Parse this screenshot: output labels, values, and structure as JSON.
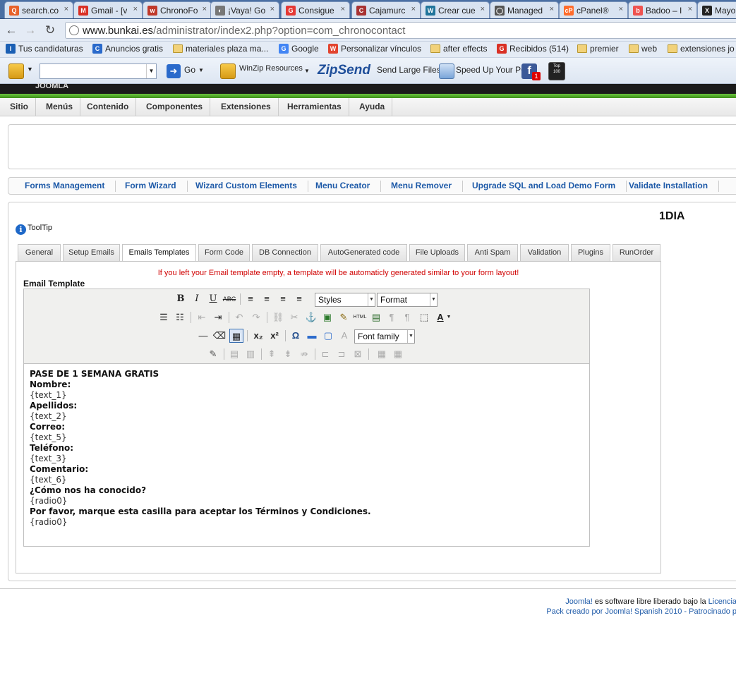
{
  "browser": {
    "tabs": [
      {
        "label": "search.co",
        "color": "#e8622a",
        "glyph": "Q"
      },
      {
        "label": "Gmail - [v",
        "color": "#d93025",
        "glyph": "M"
      },
      {
        "label": "ChronoFo",
        "color": "#c0392b",
        "glyph": "w"
      },
      {
        "label": "¡Vaya! Go",
        "color": "#777777",
        "glyph": "◐"
      },
      {
        "label": "Consigue",
        "color": "#e53935",
        "glyph": "G"
      },
      {
        "label": "Cajamurc",
        "color": "#a83232",
        "glyph": "C"
      },
      {
        "label": "Crear cue",
        "color": "#21759b",
        "glyph": "W"
      },
      {
        "label": "Managed",
        "color": "#555555",
        "glyph": "◯"
      },
      {
        "label": "cPanel®",
        "color": "#ff6c2c",
        "glyph": "cP"
      },
      {
        "label": "Badoo – I",
        "color": "#ef5350",
        "glyph": "b"
      },
      {
        "label": "Mayo",
        "color": "#222222",
        "glyph": "X"
      }
    ],
    "url_host": "www.bunkai.es",
    "url_path": "/administrator/index2.php?option=com_chronocontact",
    "bookmarks": [
      {
        "label": "Tus candidaturas",
        "icon": "infojobs-icon",
        "color": "#1a5fb4"
      },
      {
        "label": "Anuncios gratis",
        "icon": "c-icon",
        "color": "#2a6acb"
      },
      {
        "label": "materiales plaza ma...",
        "icon": "folder-icon",
        "color": ""
      },
      {
        "label": "Google",
        "icon": "google-icon",
        "color": "#4285f4"
      },
      {
        "label": "Personalizar vínculos",
        "icon": "windows-icon",
        "color": "#e2442f"
      },
      {
        "label": "after effects",
        "icon": "folder-icon",
        "color": ""
      },
      {
        "label": "Recibidos (514)",
        "icon": "gmail-icon",
        "color": "#d93025"
      },
      {
        "label": "premier",
        "icon": "folder-icon",
        "color": ""
      },
      {
        "label": "web",
        "icon": "folder-icon",
        "color": ""
      },
      {
        "label": "extensiones jo",
        "icon": "folder-icon",
        "color": ""
      }
    ],
    "toolbar": {
      "go_label": "Go",
      "winzip_label": "WinZip Resources",
      "zipsend_label": "ZipSend",
      "send_files_label": "Send Large Files",
      "speed_label": "Speed Up Your PC",
      "fb_badge": "1",
      "top_badge": "Top 100"
    }
  },
  "joomla": {
    "logo_text": "JOOMLA",
    "menu": [
      "Sitio",
      "Menús",
      "Contenido",
      "Componentes",
      "Extensiones",
      "Herramientas",
      "Ayuda"
    ],
    "submenu": [
      "Forms Management",
      "Form Wizard",
      "Wizard Custom Elements",
      "Menu Creator",
      "Menu Remover",
      "Upgrade SQL and Load Demo Form",
      "Validate Installation"
    ],
    "form_name": "1DIA",
    "tooltip_label": "ToolTip",
    "tabs": [
      "General",
      "Setup Emails",
      "Emails Templates",
      "Form Code",
      "DB Connection",
      "AutoGenerated code",
      "File Uploads",
      "Anti Spam",
      "Validation",
      "Plugins",
      "RunOrder"
    ],
    "active_tab": "Emails Templates",
    "warning": "If you left your Email template empty, a template will be automaticly generated similar to your form layout!",
    "email_template_label": "Email Template",
    "editor": {
      "styles_label": "Styles",
      "format_label": "Format",
      "font_family_label": "Font family",
      "content": [
        {
          "text": "PASE DE 1 SEMANA GRATIS",
          "bold": true
        },
        {
          "text": "Nombre:",
          "bold": true
        },
        {
          "text": "{text_1}",
          "bold": false
        },
        {
          "text": "Apellidos:",
          "bold": true
        },
        {
          "text": "{text_2}",
          "bold": false
        },
        {
          "text": "Correo:",
          "bold": true
        },
        {
          "text": "{text_5}",
          "bold": false
        },
        {
          "text": "Teléfono:",
          "bold": true
        },
        {
          "text": "{text_3}",
          "bold": false
        },
        {
          "text": "Comentario:",
          "bold": true
        },
        {
          "text": "{text_6}",
          "bold": false
        },
        {
          "text": "¿Cómo nos ha conocido?",
          "bold": true
        },
        {
          "text": "{radio0}",
          "bold": false
        },
        {
          "text": "Por favor, marque esta casilla para aceptar los Términos y Condiciones.",
          "bold": true
        },
        {
          "text": "{radio0}",
          "bold": false
        }
      ]
    },
    "footer": {
      "line1_link": "Joomla!",
      "line1_text": " es software libre liberado bajo la ",
      "line1_link2": "Licencia",
      "line2": "Pack creado por Joomla! Spanish 2010 - Patrocinado p"
    }
  }
}
